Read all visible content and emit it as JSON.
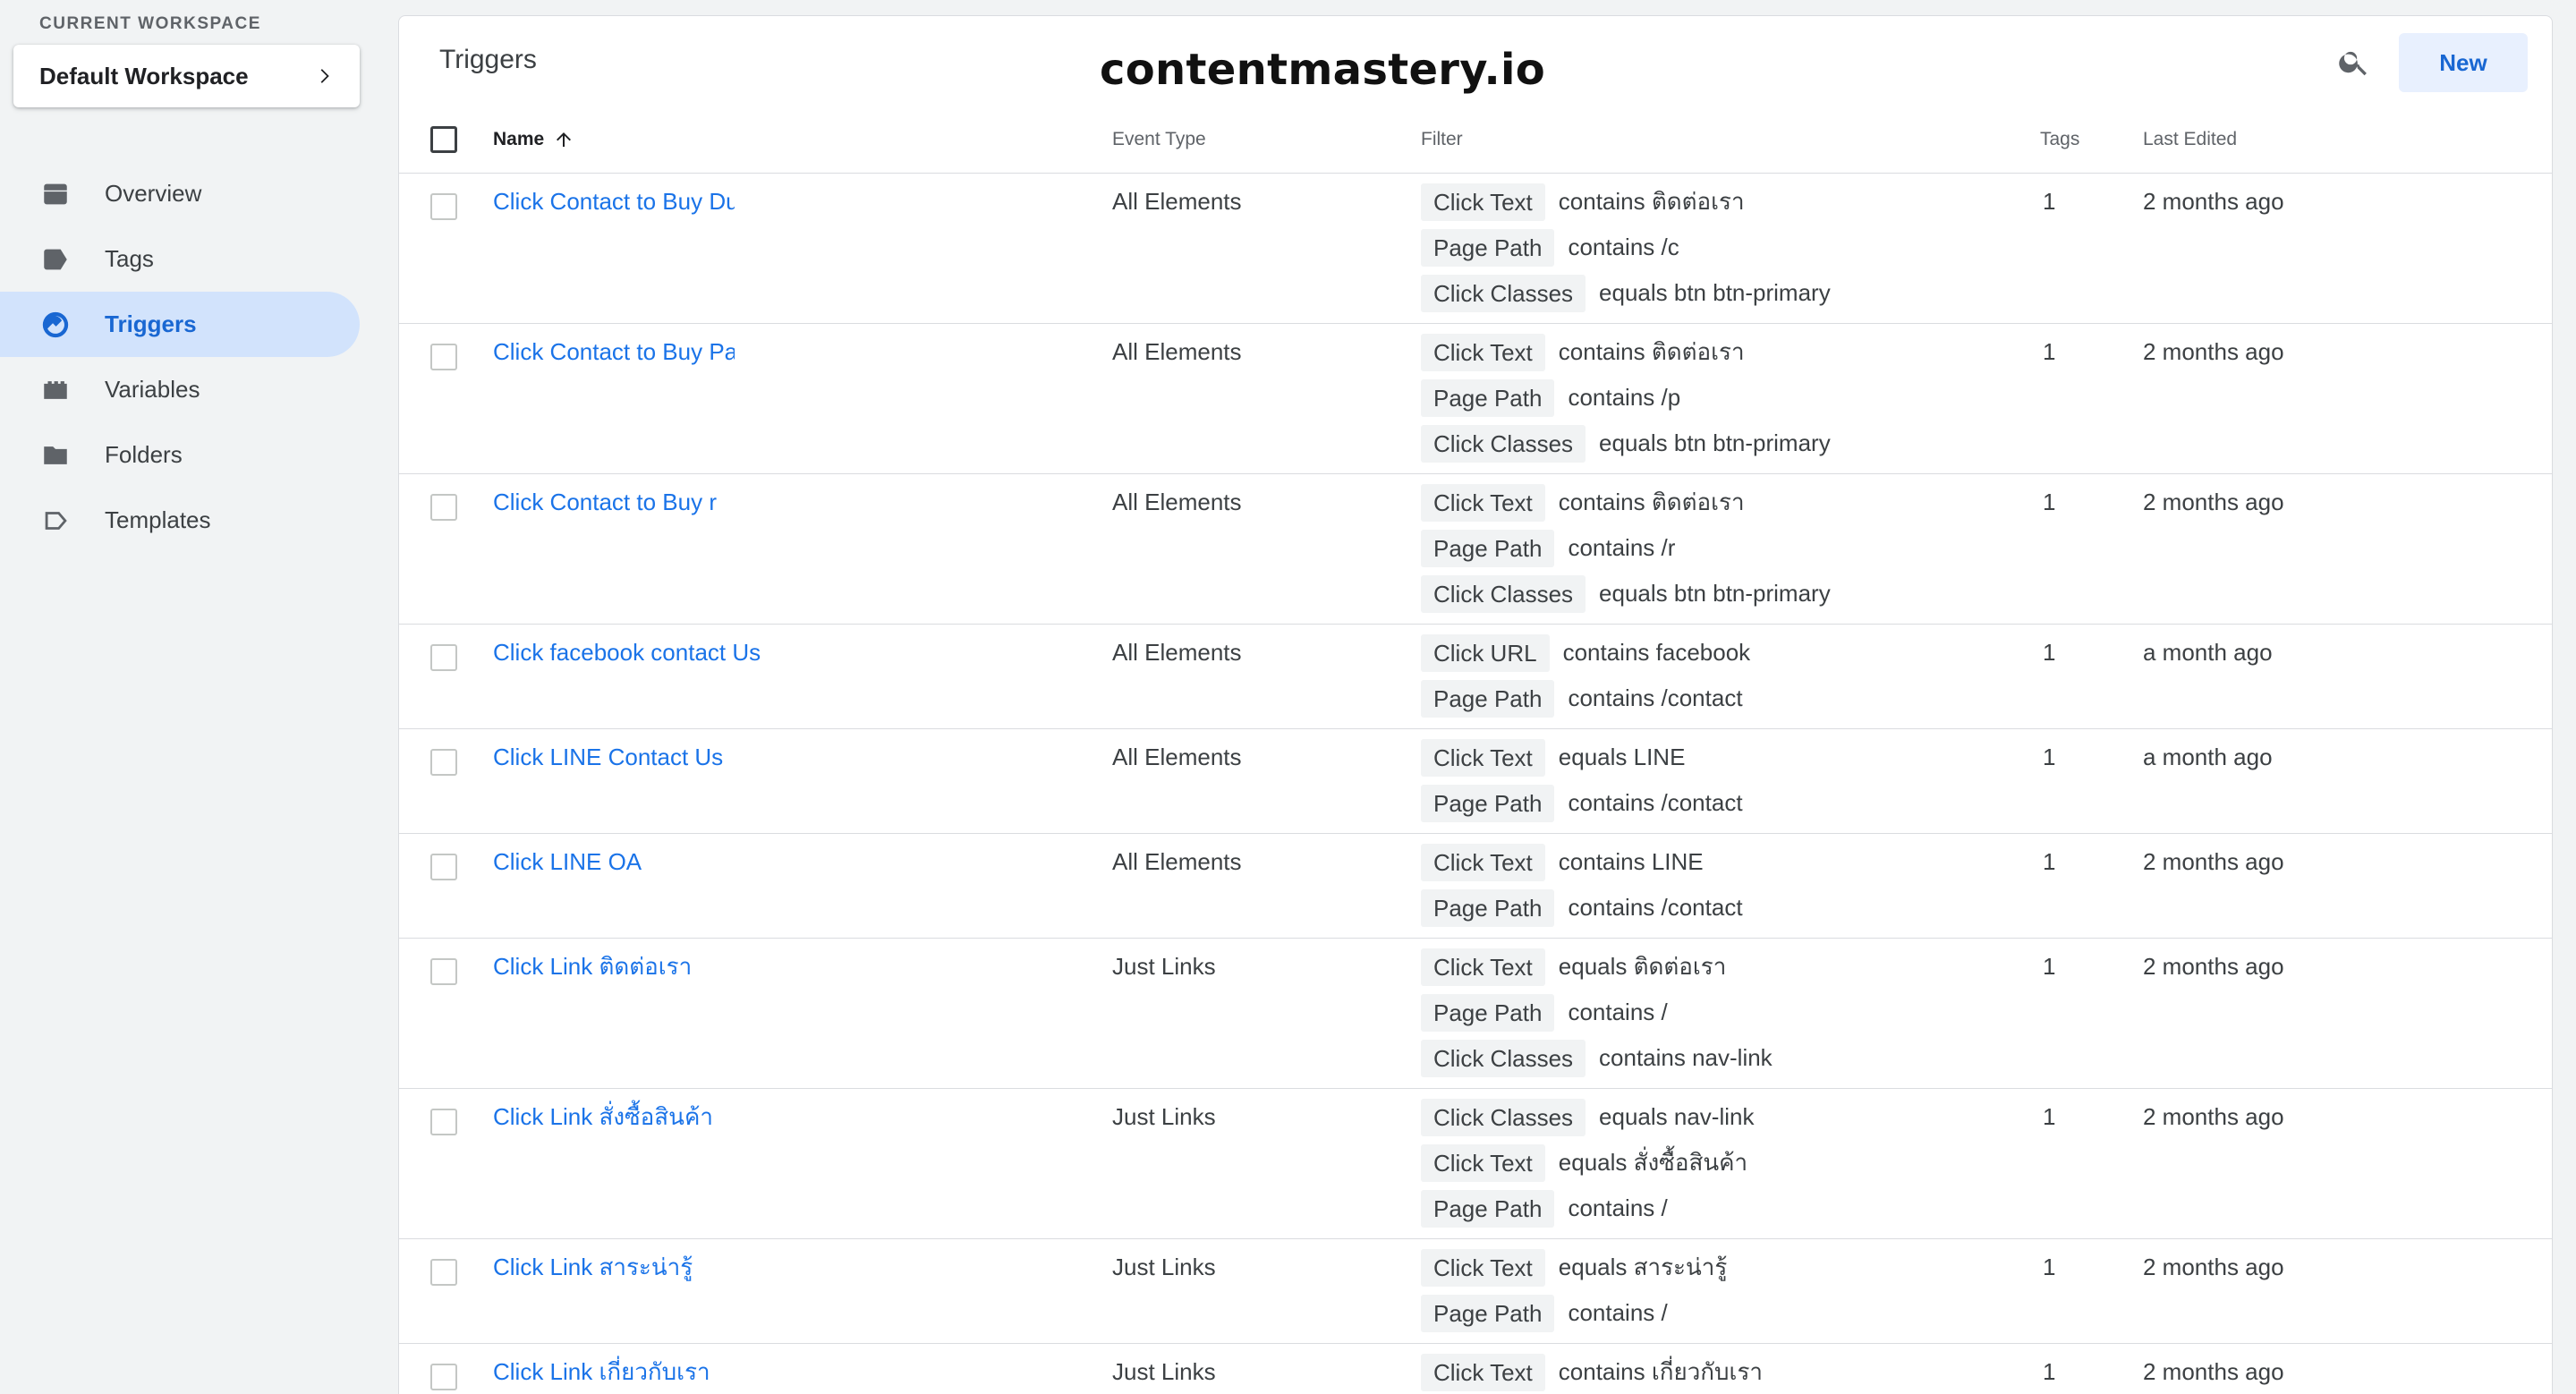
{
  "workspace": {
    "label": "CURRENT WORKSPACE",
    "name": "Default Workspace"
  },
  "nav": [
    {
      "label": "Overview",
      "icon": "overview-icon",
      "active": false
    },
    {
      "label": "Tags",
      "icon": "tag-icon",
      "active": false
    },
    {
      "label": "Triggers",
      "icon": "trigger-icon",
      "active": true
    },
    {
      "label": "Variables",
      "icon": "variables-icon",
      "active": false
    },
    {
      "label": "Folders",
      "icon": "folder-icon",
      "active": false
    },
    {
      "label": "Templates",
      "icon": "template-icon",
      "active": false
    }
  ],
  "panel": {
    "title": "Triggers",
    "brand": "contentmastery.io",
    "new_label": "New"
  },
  "columns": {
    "name": "Name",
    "event": "Event Type",
    "filter": "Filter",
    "tags": "Tags",
    "edited": "Last Edited"
  },
  "rows": [
    {
      "name": "Click Contact to Buy Du",
      "event": "All Elements",
      "tags": "1",
      "edited": "2 months ago",
      "filters": [
        {
          "field": "Click Text",
          "cond": "contains ติดต่อเรา"
        },
        {
          "field": "Page Path",
          "cond": "contains /c"
        },
        {
          "field": "Click Classes",
          "cond": "equals btn btn-primary"
        }
      ]
    },
    {
      "name": "Click Contact to Buy Pa",
      "event": "All Elements",
      "tags": "1",
      "edited": "2 months ago",
      "filters": [
        {
          "field": "Click Text",
          "cond": "contains ติดต่อเรา"
        },
        {
          "field": "Page Path",
          "cond": "contains /p"
        },
        {
          "field": "Click Classes",
          "cond": "equals btn btn-primary"
        }
      ]
    },
    {
      "name": "Click Contact to Buy r",
      "event": "All Elements",
      "tags": "1",
      "edited": "2 months ago",
      "filters": [
        {
          "field": "Click Text",
          "cond": "contains ติดต่อเรา"
        },
        {
          "field": "Page Path",
          "cond": "contains /r"
        },
        {
          "field": "Click Classes",
          "cond": "equals btn btn-primary"
        }
      ]
    },
    {
      "name": "Click facebook contact Us",
      "event": "All Elements",
      "tags": "1",
      "edited": "a month ago",
      "filters": [
        {
          "field": "Click URL",
          "cond": "contains facebook"
        },
        {
          "field": "Page Path",
          "cond": "contains /contact"
        }
      ]
    },
    {
      "name": "Click LINE Contact Us",
      "event": "All Elements",
      "tags": "1",
      "edited": "a month ago",
      "filters": [
        {
          "field": "Click Text",
          "cond": "equals LINE"
        },
        {
          "field": "Page Path",
          "cond": "contains /contact"
        }
      ]
    },
    {
      "name": "Click LINE OA",
      "event": "All Elements",
      "tags": "1",
      "edited": "2 months ago",
      "filters": [
        {
          "field": "Click Text",
          "cond": "contains LINE"
        },
        {
          "field": "Page Path",
          "cond": "contains /contact"
        }
      ]
    },
    {
      "name": "Click Link ติดต่อเรา",
      "event": "Just Links",
      "tags": "1",
      "edited": "2 months ago",
      "filters": [
        {
          "field": "Click Text",
          "cond": "equals ติดต่อเรา"
        },
        {
          "field": "Page Path",
          "cond": "contains /"
        },
        {
          "field": "Click Classes",
          "cond": "contains nav-link"
        }
      ]
    },
    {
      "name": "Click Link สั่งซื้อสินค้า",
      "event": "Just Links",
      "tags": "1",
      "edited": "2 months ago",
      "filters": [
        {
          "field": "Click Classes",
          "cond": "equals nav-link"
        },
        {
          "field": "Click Text",
          "cond": "equals สั่งซื้อสินค้า"
        },
        {
          "field": "Page Path",
          "cond": "contains /"
        }
      ]
    },
    {
      "name": "Click Link สาระน่ารู้",
      "event": "Just Links",
      "tags": "1",
      "edited": "2 months ago",
      "filters": [
        {
          "field": "Click Text",
          "cond": "equals สาระน่ารู้"
        },
        {
          "field": "Page Path",
          "cond": "contains /"
        }
      ]
    },
    {
      "name": "Click Link เกี่ยวกับเรา",
      "event": "Just Links",
      "tags": "1",
      "edited": "2 months ago",
      "filters": [
        {
          "field": "Click Text",
          "cond": "contains เกี่ยวกับเรา"
        }
      ]
    }
  ]
}
